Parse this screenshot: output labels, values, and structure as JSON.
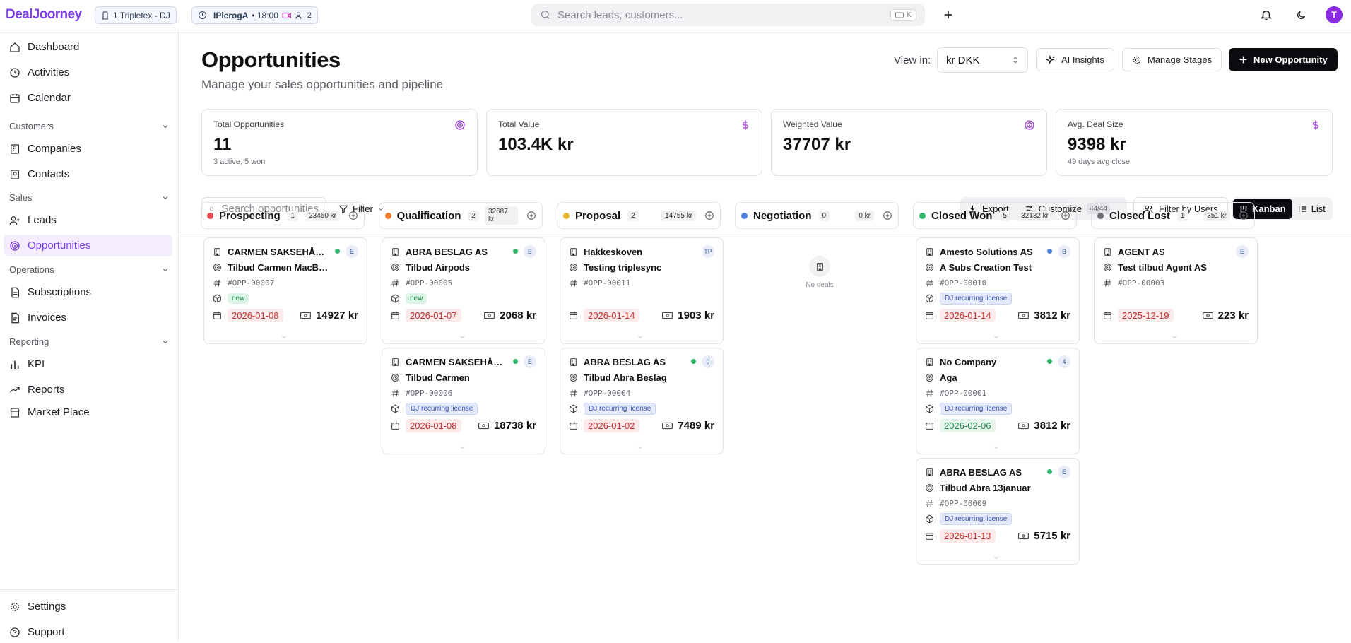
{
  "app": {
    "logo": "DealJoorney"
  },
  "topbar": {
    "workspace": "1 Tripletex - DJ",
    "session_user": "IPierogA",
    "session_time": "• 18:00",
    "session_count": "2",
    "search_placeholder": "Search leads, customers...",
    "search_shortcut": "K",
    "avatar_initial": "T"
  },
  "sidebar": {
    "items": {
      "dashboard": "Dashboard",
      "activities": "Activities",
      "calendar": "Calendar",
      "companies": "Companies",
      "contacts": "Contacts",
      "leads": "Leads",
      "opportunities": "Opportunities",
      "subscriptions": "Subscriptions",
      "invoices": "Invoices",
      "kpi": "KPI",
      "reports": "Reports",
      "marketplace": "Market Place",
      "settings": "Settings",
      "support": "Support"
    },
    "sections": {
      "customers": "Customers",
      "sales": "Sales",
      "operations": "Operations",
      "reporting": "Reporting"
    }
  },
  "page": {
    "title": "Opportunities",
    "subtitle": "Manage your sales opportunities and pipeline",
    "view_in_label": "View in:",
    "currency": "kr DKK",
    "ai_insights": "AI Insights",
    "manage_stages": "Manage Stages",
    "new_opportunity": "New Opportunity"
  },
  "stats": [
    {
      "label": "Total Opportunities",
      "value": "11",
      "sub": "3 active, 5 won"
    },
    {
      "label": "Total Value",
      "value": "103.4K kr",
      "sub": ""
    },
    {
      "label": "Weighted Value",
      "value": "37707 kr",
      "sub": ""
    },
    {
      "label": "Avg. Deal Size",
      "value": "9398 kr",
      "sub": "49 days avg close"
    }
  ],
  "toolbar": {
    "search_placeholder": "Search opportunities",
    "filter": "Filter",
    "export": "Export",
    "customize": "Customize",
    "customize_count": "44/44",
    "filter_by_users": "Filter by Users",
    "kanban": "Kanban",
    "list": "List"
  },
  "colors": {
    "accent": "#7b3fe4",
    "prospecting": "#e5484d",
    "qualification": "#f07a2a",
    "proposal": "#e8b22c",
    "negotiation": "#4a7fe0",
    "closed_won": "#2fb56a",
    "closed_lost": "#6b6b74"
  },
  "columns": [
    {
      "name": "Prospecting",
      "count": "1",
      "total": "23450 kr",
      "empty_text": "",
      "cards": [
        {
          "company": "CARMEN SAKSEHÅNDTERING",
          "title": "Tilbud Carmen MacBook",
          "code": "#OPP-00007",
          "tag": "new",
          "tag_type": "new",
          "date": "2026-01-08",
          "date_type": "red",
          "amount": "14927 kr",
          "user": "E",
          "dot": "#2fb56a"
        }
      ]
    },
    {
      "name": "Qualification",
      "count": "2",
      "total": "32687 kr",
      "empty_text": "",
      "cards": [
        {
          "company": "ABRA BESLAG AS",
          "title": "Tilbud Airpods",
          "code": "#OPP-00005",
          "tag": "new",
          "tag_type": "new",
          "date": "2026-01-07",
          "date_type": "red",
          "amount": "2068 kr",
          "user": "E",
          "dot": "#2fb56a"
        },
        {
          "company": "CARMEN SAKSEHÅNDTERING",
          "title": "Tilbud Carmen",
          "code": "#OPP-00006",
          "tag": "DJ recurring license",
          "tag_type": "lic",
          "date": "2026-01-08",
          "date_type": "red",
          "amount": "18738 kr",
          "user": "E",
          "dot": "#2fb56a"
        }
      ]
    },
    {
      "name": "Proposal",
      "count": "2",
      "total": "14755 kr",
      "empty_text": "",
      "cards": [
        {
          "company": "Hakkeskoven",
          "title": "Testing triplesync",
          "code": "#OPP-00011",
          "tag": "",
          "tag_type": "",
          "date": "2026-01-14",
          "date_type": "red",
          "amount": "1903 kr",
          "user": "TP",
          "dot": ""
        },
        {
          "company": "ABRA BESLAG AS",
          "title": "Tilbud Abra Beslag",
          "code": "#OPP-00004",
          "tag": "DJ recurring license",
          "tag_type": "lic",
          "date": "2026-01-02",
          "date_type": "red",
          "amount": "7489 kr",
          "user": "0",
          "dot": "#2fb56a"
        }
      ]
    },
    {
      "name": "Negotiation",
      "count": "0",
      "total": "0 kr",
      "empty_text": "No deals",
      "cards": []
    },
    {
      "name": "Closed Won",
      "count": "5",
      "total": "32132 kr",
      "empty_text": "",
      "cards": [
        {
          "company": "Amesto Solutions AS",
          "title": "A Subs Creation Test",
          "code": "#OPP-00010",
          "tag": "DJ recurring license",
          "tag_type": "lic",
          "date": "2026-01-14",
          "date_type": "red",
          "amount": "3812 kr",
          "user": "B",
          "dot": "#4a7fe0"
        },
        {
          "company": "No Company",
          "title": "Aga",
          "code": "#OPP-00001",
          "tag": "DJ recurring license",
          "tag_type": "lic",
          "date": "2026-02-06",
          "date_type": "green",
          "amount": "3812 kr",
          "user": "4",
          "dot": "#2fb56a"
        },
        {
          "company": "ABRA BESLAG AS",
          "title": "Tilbud Abra 13januar",
          "code": "#OPP-00009",
          "tag": "DJ recurring license",
          "tag_type": "lic",
          "date": "2026-01-13",
          "date_type": "red",
          "amount": "5715 kr",
          "user": "E",
          "dot": "#2fb56a"
        }
      ]
    },
    {
      "name": "Closed Lost",
      "count": "1",
      "total": "351 kr",
      "empty_text": "",
      "cards": [
        {
          "company": "AGENT AS",
          "title": "Test tilbud Agent AS",
          "code": "#OPP-00003",
          "tag": "",
          "tag_type": "",
          "date": "2025-12-19",
          "date_type": "red",
          "amount": "223 kr",
          "user": "E",
          "dot": ""
        }
      ]
    }
  ]
}
